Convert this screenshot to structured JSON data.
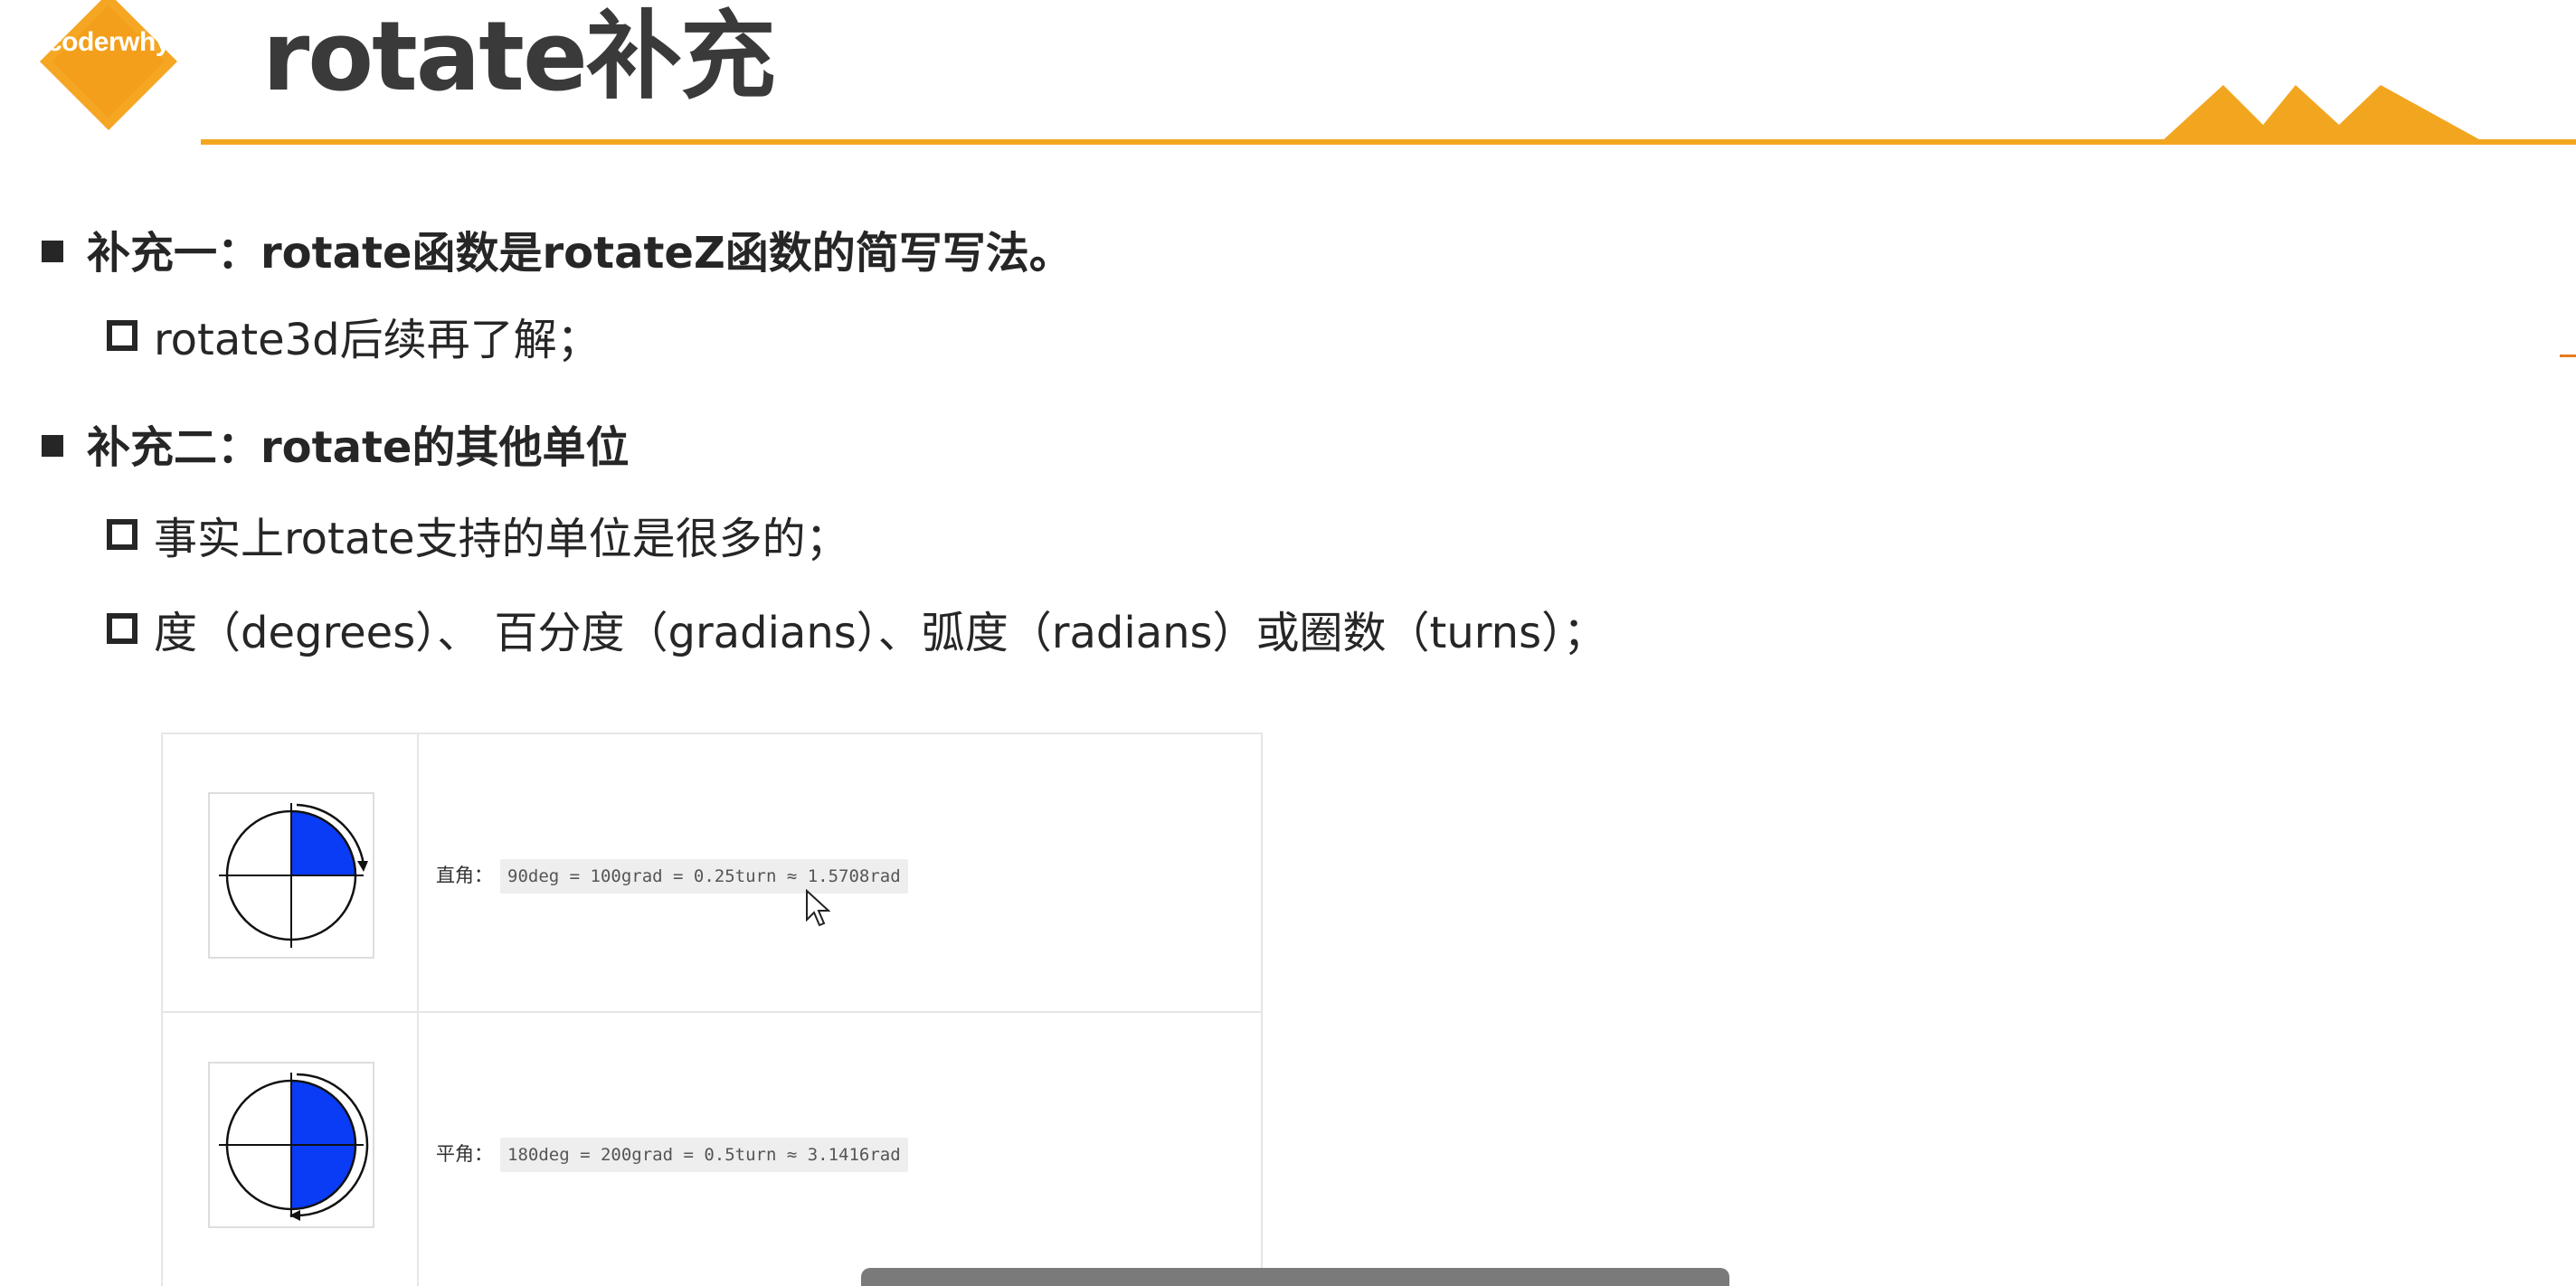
{
  "header": {
    "logo_text": "coderwhy",
    "title": "rotate补充",
    "accent_color": "#f2a61f"
  },
  "bullets": [
    {
      "label": "补充一：rotate函数是rotateZ函数的简写写法。",
      "subitems": [
        "rotate3d后续再了解；"
      ]
    },
    {
      "label": "补充二：rotate的其他单位",
      "subitems": [
        "事实上rotate支持的单位是很多的；",
        "度（degrees）、 百分度（gradians）、弧度（radians）或圈数（turns）；"
      ]
    }
  ],
  "units_table": {
    "rows": [
      {
        "label": "直角：",
        "code": "90deg = 100grad = 0.25turn ≈ 1.5708rad",
        "icon": "quarter-circle-rotation-icon",
        "fraction_filled": 0.25,
        "fill_color": "#0a3cf5"
      },
      {
        "label": "平角：",
        "code": "180deg = 200grad = 0.5turn ≈ 3.1416rad",
        "icon": "half-circle-rotation-icon",
        "fraction_filled": 0.5,
        "fill_color": "#0a3cf5"
      }
    ]
  }
}
